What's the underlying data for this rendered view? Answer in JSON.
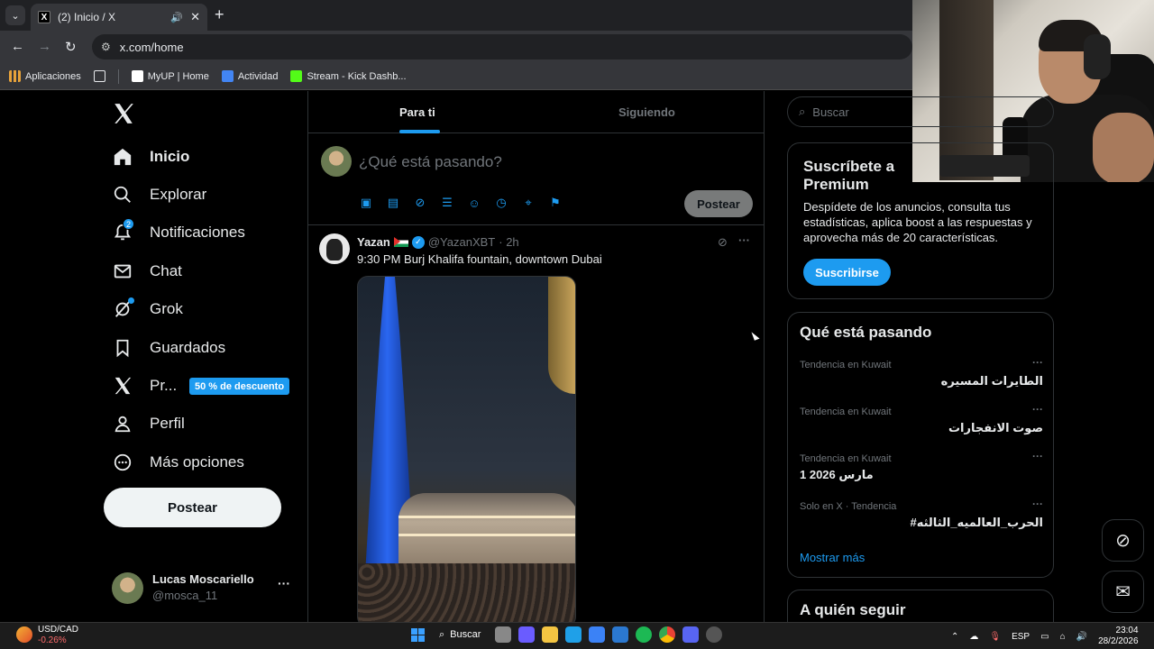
{
  "browser": {
    "tab_title": "(2) Inicio / X",
    "url": "x.com/home",
    "bookmarks": [
      {
        "label": "Aplicaciones",
        "color": "#e8a33a"
      },
      {
        "label": "MyUP | Home",
        "color": "#ffffff"
      },
      {
        "label": "Actividad",
        "color": "#4285f4"
      },
      {
        "label": "Stream - Kick Dashb...",
        "color": "#53fc18"
      }
    ]
  },
  "x": {
    "nav": [
      {
        "label": "Inicio",
        "icon": "home-icon"
      },
      {
        "label": "Explorar",
        "icon": "search-icon"
      },
      {
        "label": "Notificaciones",
        "icon": "bell-icon",
        "badge": "2"
      },
      {
        "label": "Chat",
        "icon": "mail-icon"
      },
      {
        "label": "Grok",
        "icon": "grok-icon"
      },
      {
        "label": "Guardados",
        "icon": "bookmark-icon"
      },
      {
        "label": "Pr...",
        "icon": "x-premium-icon"
      },
      {
        "label": "Perfil",
        "icon": "person-icon"
      },
      {
        "label": "Más opciones",
        "icon": "more-circle-icon"
      }
    ],
    "premium_badge": "50 % de descuento",
    "post_button": "Postear",
    "account": {
      "name": "Lucas Moscariello",
      "handle": "@mosca_11",
      "more": "···"
    },
    "feed_tabs": {
      "for_you": "Para ti",
      "following": "Siguiendo"
    },
    "composer": {
      "placeholder": "¿Qué está pasando?",
      "post": "Postear"
    },
    "tweet": {
      "name": "Yazan",
      "handle": "@YazanXBT",
      "time": "· 2h",
      "text": "9:30 PM Burj Khalifa fountain, downtown Dubai",
      "more": "···"
    },
    "search_placeholder": "Buscar",
    "premium_card": {
      "title": "Suscríbete a Premium",
      "desc": "Despídete de los anuncios, consulta tus estadísticas, aplica boost a las respuestas y aprovecha más de 20 características.",
      "button": "Suscribirse"
    },
    "trends": {
      "title": "Qué está pasando",
      "items": [
        {
          "context": "Tendencia en Kuwait",
          "name": "الطايرات المسيره"
        },
        {
          "context": "Tendencia en Kuwait",
          "name": "صوت الانفجارات"
        },
        {
          "context": "Tendencia en Kuwait",
          "name": "1 مارس 2026"
        },
        {
          "context": "Solo en X · Tendencia",
          "name": "#الحرب_العالميه_الثالثه"
        }
      ],
      "more_dots": "···",
      "show_more": "Mostrar más"
    },
    "who_to_follow": "A quién seguir",
    "accent": "#1d9bf0"
  },
  "taskbar": {
    "ticker": "USD/CAD",
    "change": "-0.26%",
    "search": "Buscar",
    "lang": "ESP",
    "time": "23:04",
    "date": "28/2/2026"
  }
}
